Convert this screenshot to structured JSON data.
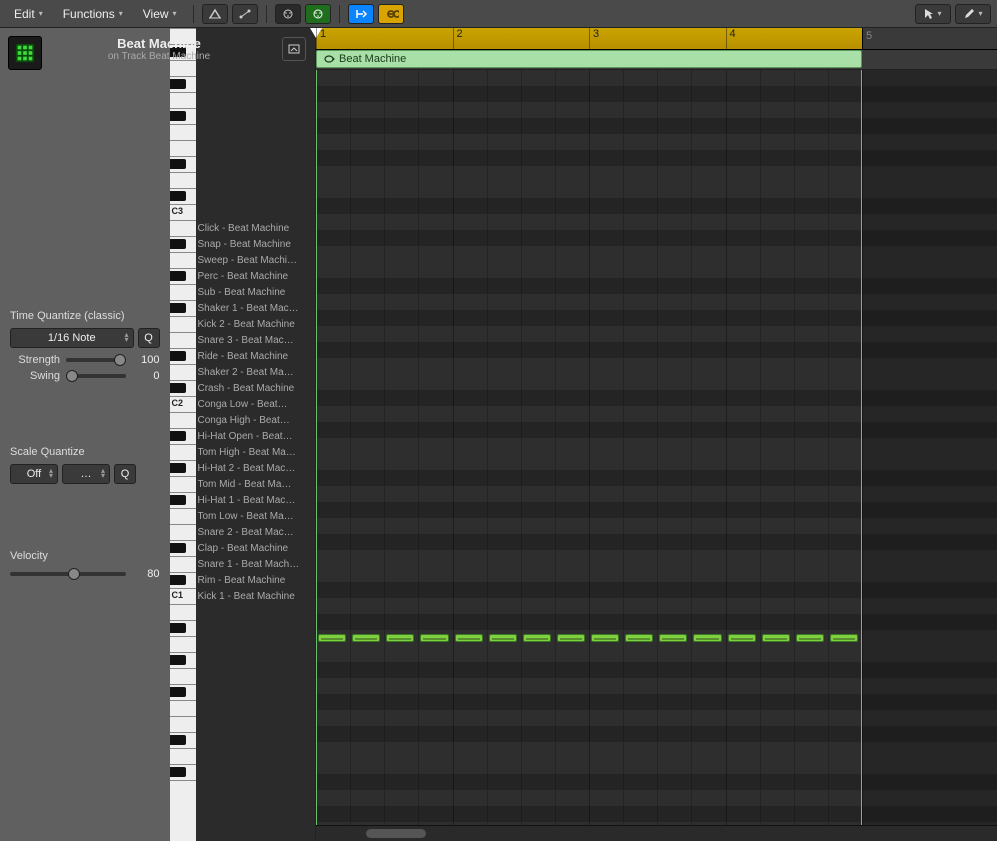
{
  "toolbar": {
    "menus": [
      "Edit",
      "Functions",
      "View"
    ],
    "pointer_label": "▾",
    "pencil_label": "▾"
  },
  "header": {
    "title": "Beat Machine",
    "subtitle": "on Track Beat Machine"
  },
  "inspector": {
    "time_quantize_label": "Time Quantize (classic)",
    "time_quantize_value": "1/16 Note",
    "q_button": "Q",
    "strength_label": "Strength",
    "strength_value": "100",
    "swing_label": "Swing",
    "swing_value": "0",
    "scale_quantize_label": "Scale Quantize",
    "scale_quantize_value": "Off",
    "scale_quantize_extra": "…",
    "velocity_label": "Velocity",
    "velocity_value": "80"
  },
  "piano": {
    "octave_labels": [
      "C3",
      "C2",
      "C1"
    ],
    "lanes": [
      "Click - Beat Machine",
      "Snap - Beat Machine",
      "Sweep - Beat Machi…",
      "Perc - Beat Machine",
      "Sub - Beat Machine",
      "Shaker 1 - Beat Mac…",
      "Kick 2 - Beat Machine",
      "Snare 3 - Beat Mac…",
      "Ride - Beat Machine",
      "Shaker 2 - Beat Ma…",
      "Crash - Beat Machine",
      "Conga Low - Beat…",
      "Conga High - Beat…",
      "Hi-Hat Open - Beat…",
      "Tom High - Beat Ma…",
      "Hi-Hat 2 - Beat Mac…",
      "Tom Mid - Beat Ma…",
      "Hi-Hat 1 - Beat Mac…",
      "Tom Low - Beat Ma…",
      "Snare 2 - Beat Mac…",
      "Clap - Beat Machine",
      "Snare 1 - Beat Mach…",
      "Rim - Beat Machine",
      "Kick 1 - Beat Machine"
    ]
  },
  "ruler": {
    "bars": [
      "1",
      "2",
      "3",
      "4",
      "5"
    ],
    "region_bars": 4
  },
  "region": {
    "name": "Beat Machine"
  },
  "notes": {
    "lane_index": 23,
    "count": 16
  },
  "colors": {
    "region": "#a8e0a8",
    "note": "#7fd040",
    "ruler": "#c9a400"
  }
}
